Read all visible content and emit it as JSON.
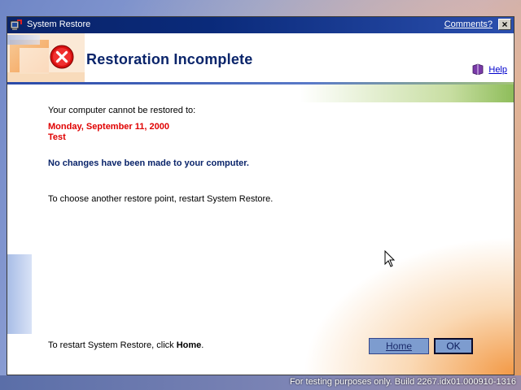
{
  "window": {
    "title": "System Restore",
    "comments_link": "Comments?",
    "close_glyph": "×"
  },
  "header": {
    "title": "Restoration Incomplete",
    "help_link": "Help",
    "error_icon": "error-x-icon",
    "help_icon": "book-icon"
  },
  "body": {
    "intro": "Your computer cannot be restored to:",
    "restore_date": "Monday, September 11, 2000",
    "restore_name": "Test",
    "no_changes": "No changes have been made to your computer.",
    "choose_another": "To choose another restore point, restart System Restore.",
    "restart_prefix": "To restart System Restore, click ",
    "restart_bold": "Home",
    "restart_suffix": "."
  },
  "buttons": {
    "home": "Home",
    "ok": "OK"
  },
  "footer": {
    "build_text": "For testing purposes only. Build 2267.idx01.000910-1316"
  },
  "colors": {
    "title_navy": "#0a246a",
    "error_red": "#e00000",
    "button_blue": "#7d9ccf",
    "accent_orange": "#f2943c"
  }
}
